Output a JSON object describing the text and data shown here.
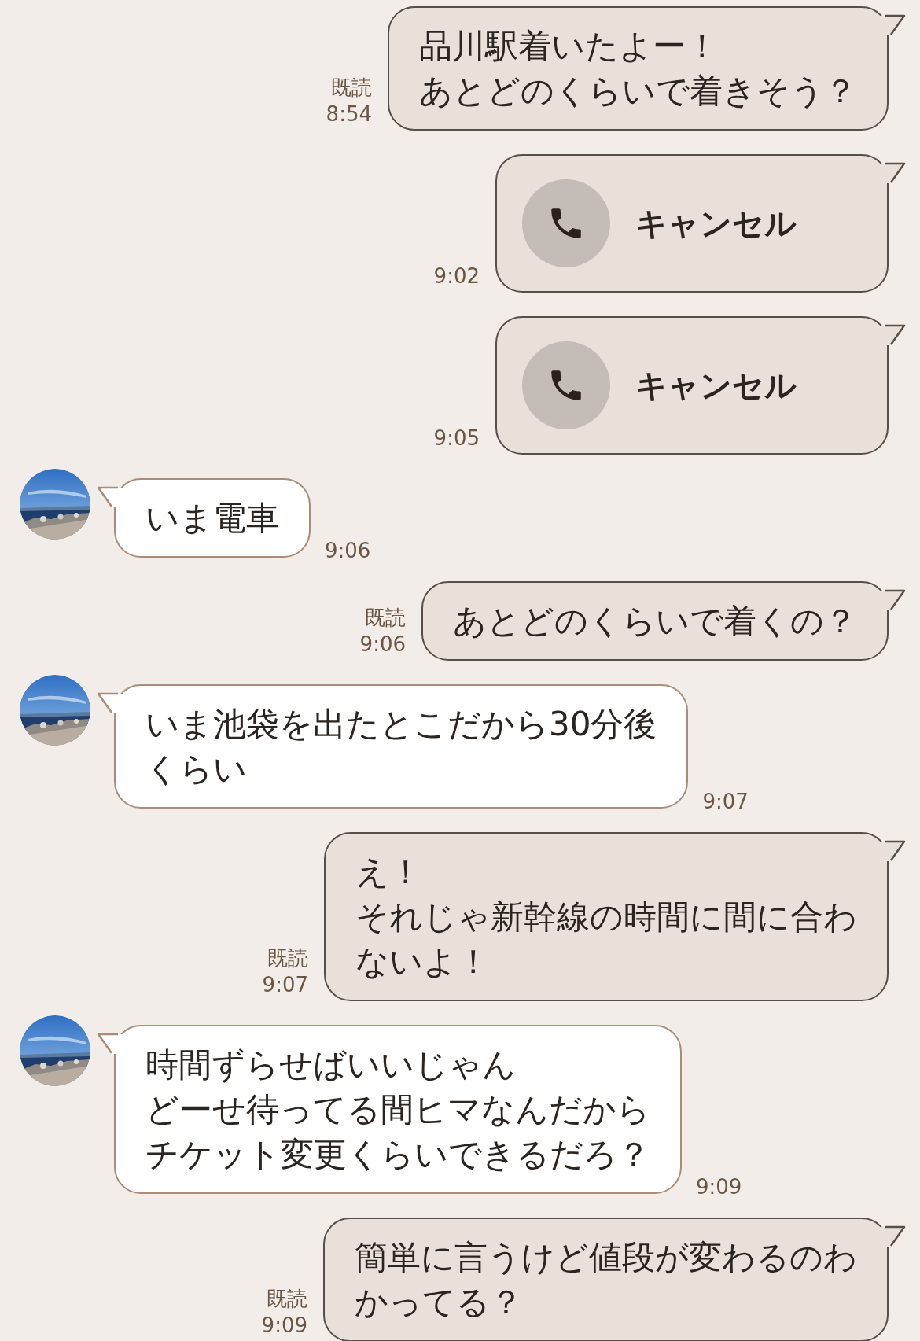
{
  "messages": [
    {
      "outgoing": true,
      "kind": "text",
      "lines": [
        "品川駅着いたよー！",
        "あとどのくらいで着きそう？"
      ],
      "read_label": "既読",
      "time": "8:54"
    },
    {
      "outgoing": true,
      "kind": "call",
      "label": "キャンセル",
      "time": "9:02"
    },
    {
      "outgoing": true,
      "kind": "call",
      "label": "キャンセル",
      "time": "9:05"
    },
    {
      "outgoing": false,
      "kind": "text",
      "lines": [
        "いま電車"
      ],
      "time": "9:06"
    },
    {
      "outgoing": true,
      "kind": "text",
      "lines": [
        "あとどのくらいで着くの？"
      ],
      "read_label": "既読",
      "time": "9:06"
    },
    {
      "outgoing": false,
      "kind": "text",
      "lines": [
        "いま池袋を出たとこだから30分後",
        "くらい"
      ],
      "time": "9:07"
    },
    {
      "outgoing": true,
      "kind": "text",
      "lines": [
        "え！",
        "それじゃ新幹線の時間に間に合わ",
        "ないよ！"
      ],
      "read_label": "既読",
      "time": "9:07"
    },
    {
      "outgoing": false,
      "kind": "text",
      "lines": [
        "時間ずらせばいいじゃん",
        "どーせ待ってる間ヒマなんだから",
        "チケット変更くらいできるだろ？"
      ],
      "time": "9:09"
    },
    {
      "outgoing": true,
      "kind": "text",
      "lines": [
        "簡単に言うけど値段が変わるのわ",
        "かってる？"
      ],
      "read_label": "既読",
      "time": "9:09"
    }
  ]
}
